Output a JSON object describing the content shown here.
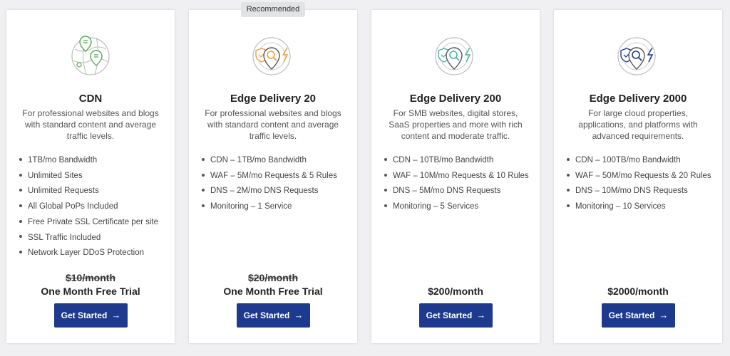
{
  "badge": "Recommended",
  "plans": [
    {
      "title": "CDN",
      "description": "For professional websites and blogs with standard content and average traffic levels.",
      "features": [
        "1TB/mo Bandwidth",
        "Unlimited Sites",
        "Unlimited Requests",
        "All Global PoPs Included",
        "Free Private SSL Certificate per site",
        "SSL Traffic Included",
        "Network Layer DDoS Protection"
      ],
      "old_price": "$10/month",
      "price": "One Month Free Trial",
      "button": "Get Started",
      "icon": "map-pin-globe-icon",
      "icon_color": "#4caf50"
    },
    {
      "title": "Edge Delivery 20",
      "description": "For professional websites and blogs with standard content and average traffic levels.",
      "features": [
        "CDN – 1TB/mo Bandwidth",
        "WAF – 5M/mo Requests & 5 Rules",
        "DNS – 2M/mo DNS Requests",
        "Monitoring – 1 Service"
      ],
      "old_price": "$20/month",
      "price": "One Month Free Trial",
      "button": "Get Started",
      "icon": "shield-search-bolt-icon",
      "icon_color": "#f0a040"
    },
    {
      "title": "Edge Delivery 200",
      "description": "For SMB websites, digital stores, SaaS properties and more with rich content and moderate traffic.",
      "features": [
        "CDN – 10TB/mo Bandwidth",
        "WAF – 10M/mo Requests & 10 Rules",
        "DNS – 5M/mo DNS Requests",
        "Monitoring – 5 Services"
      ],
      "old_price": "",
      "price": "$200/month",
      "button": "Get Started",
      "icon": "shield-search-bolt-icon",
      "icon_color": "#4db6a0"
    },
    {
      "title": "Edge Delivery 2000",
      "description": "For large cloud properties, applications, and platforms with advanced requirements.",
      "features": [
        "CDN – 100TB/mo Bandwidth",
        "WAF – 50M/mo Requests & 20 Rules",
        "DNS – 10M/mo DNS Requests",
        "Monitoring – 10 Services"
      ],
      "old_price": "",
      "price": "$2000/month",
      "button": "Get Started",
      "icon": "shield-search-bolt-icon",
      "icon_color": "#1d3a8f"
    }
  ]
}
